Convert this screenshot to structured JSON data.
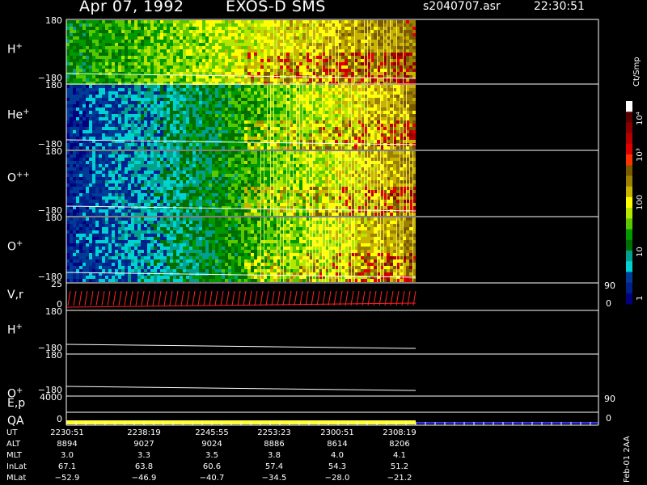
{
  "header": {
    "date": "Apr 07, 1992",
    "mission": "EXOS-D SMS",
    "file": "s2040707.asr",
    "time": "22:30:51"
  },
  "panels": [
    {
      "label": "H",
      "sup": "+",
      "ymax": "180",
      "ymin": "−180"
    },
    {
      "label": "He",
      "sup": "+",
      "ymax": "180",
      "ymin": "−180"
    },
    {
      "label": "O",
      "sup": "++",
      "ymax": "180",
      "ymin": "−180"
    },
    {
      "label": "O",
      "sup": "+",
      "ymax": "180",
      "ymin": "−180"
    },
    {
      "label": "V,r",
      "sup": "",
      "ymax": "25",
      "ymin": "0",
      "rmax": "90",
      "rmin": "0"
    },
    {
      "label": "H",
      "sup": "+",
      "ymax": "180",
      "ymin": "−180"
    },
    {
      "label": "O",
      "sup": "+",
      "ymax": "180",
      "ymin": "−180"
    },
    {
      "label": "E,p",
      "sup": "",
      "ymax": "4000",
      "ymin": "",
      "rmax": "90",
      "rmin": ""
    },
    {
      "label": "QA",
      "sup": "",
      "ymax": "",
      "ymin": "0",
      "rmax": "",
      "rmin": "0"
    }
  ],
  "colorbar": {
    "unit": "Ct/Smp",
    "tick_labels": [
      "10⁴",
      "10³",
      "100",
      "10",
      "1"
    ],
    "colors": [
      "#ffffff",
      "#5a0000",
      "#8a0000",
      "#b50000",
      "#e00000",
      "#ff3300",
      "#7a5a00",
      "#9e8000",
      "#c8b400",
      "#ffff00",
      "#b4e600",
      "#5ac800",
      "#009a00",
      "#006e00",
      "#00a08c",
      "#00d2d2",
      "#003c96",
      "#00208c",
      "#000080"
    ]
  },
  "table": {
    "row_labels": [
      "UT",
      "ALT",
      "MLT",
      "InLat",
      "MLat"
    ],
    "columns": [
      {
        "UT": "2230:51",
        "ALT": "8894",
        "MLT": "3.0",
        "InLat": "67.1",
        "MLat": "−52.9"
      },
      {
        "UT": "2238:19",
        "ALT": "9027",
        "MLT": "3.3",
        "InLat": "63.8",
        "MLat": "−46.9"
      },
      {
        "UT": "2245:55",
        "ALT": "9024",
        "MLT": "3.5",
        "InLat": "60.6",
        "MLat": "−40.7"
      },
      {
        "UT": "2253:23",
        "ALT": "8886",
        "MLT": "3.8",
        "InLat": "57.4",
        "MLat": "−34.5"
      },
      {
        "UT": "2300:51",
        "ALT": "8614",
        "MLT": "4.0",
        "InLat": "54.3",
        "MLat": "−28.0"
      },
      {
        "UT": "2308:19",
        "ALT": "8206",
        "MLT": "4.1",
        "InLat": "51.2",
        "MLat": "−21.2"
      }
    ]
  },
  "footer": "Feb-01 2AA",
  "chart_data": {
    "type": "heatmap",
    "title": "Apr 07, 1992   EXOS-D SMS",
    "x": {
      "unit": "UT",
      "ticks": [
        "2230:51",
        "2238:19",
        "2245:55",
        "2253:23",
        "2300:51",
        "2308:19"
      ]
    },
    "ylim": [
      -180,
      180
    ],
    "zscale": "log",
    "zrange": [
      1,
      10000
    ],
    "series": [
      {
        "name": "H+",
        "kind": "spectrogram"
      },
      {
        "name": "He+",
        "kind": "spectrogram"
      },
      {
        "name": "O++",
        "kind": "spectrogram"
      },
      {
        "name": "O+",
        "kind": "spectrogram"
      }
    ]
  }
}
